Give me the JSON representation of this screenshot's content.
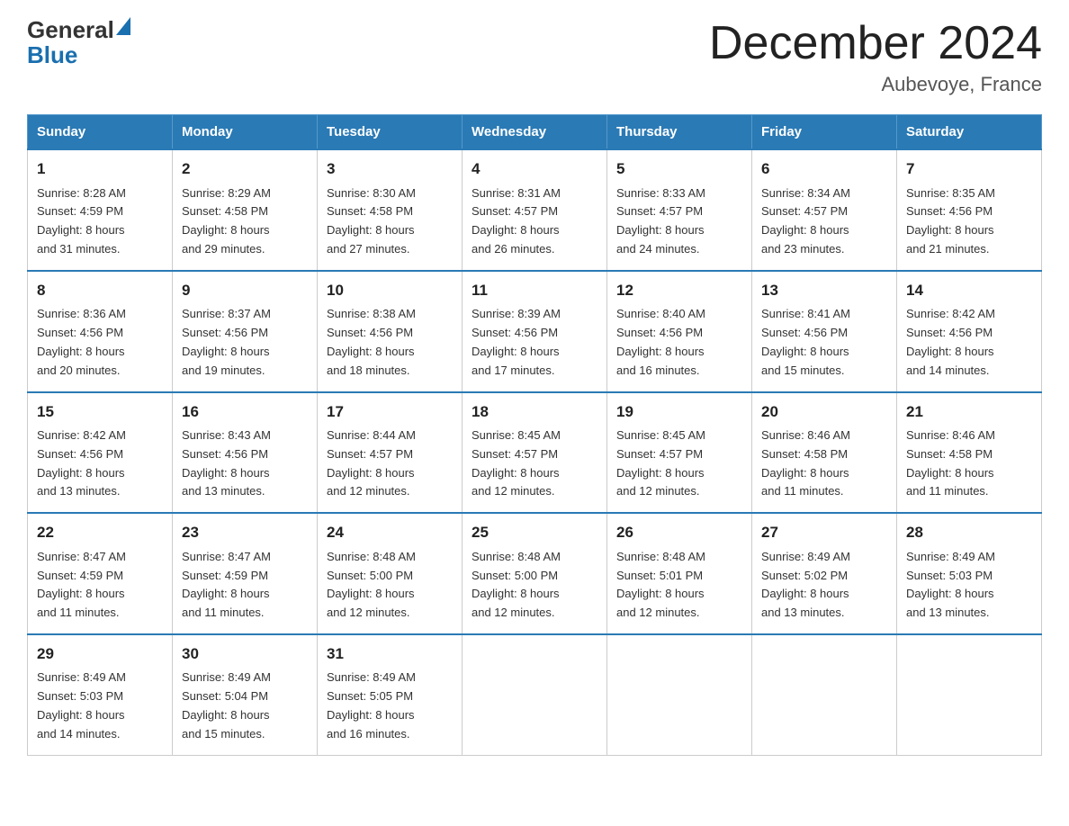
{
  "header": {
    "logo_general": "General",
    "logo_blue": "Blue",
    "month_title": "December 2024",
    "location": "Aubevoye, France"
  },
  "days_of_week": [
    "Sunday",
    "Monday",
    "Tuesday",
    "Wednesday",
    "Thursday",
    "Friday",
    "Saturday"
  ],
  "weeks": [
    [
      {
        "day": "1",
        "sunrise": "8:28 AM",
        "sunset": "4:59 PM",
        "daylight": "8 hours and 31 minutes."
      },
      {
        "day": "2",
        "sunrise": "8:29 AM",
        "sunset": "4:58 PM",
        "daylight": "8 hours and 29 minutes."
      },
      {
        "day": "3",
        "sunrise": "8:30 AM",
        "sunset": "4:58 PM",
        "daylight": "8 hours and 27 minutes."
      },
      {
        "day": "4",
        "sunrise": "8:31 AM",
        "sunset": "4:57 PM",
        "daylight": "8 hours and 26 minutes."
      },
      {
        "day": "5",
        "sunrise": "8:33 AM",
        "sunset": "4:57 PM",
        "daylight": "8 hours and 24 minutes."
      },
      {
        "day": "6",
        "sunrise": "8:34 AM",
        "sunset": "4:57 PM",
        "daylight": "8 hours and 23 minutes."
      },
      {
        "day": "7",
        "sunrise": "8:35 AM",
        "sunset": "4:56 PM",
        "daylight": "8 hours and 21 minutes."
      }
    ],
    [
      {
        "day": "8",
        "sunrise": "8:36 AM",
        "sunset": "4:56 PM",
        "daylight": "8 hours and 20 minutes."
      },
      {
        "day": "9",
        "sunrise": "8:37 AM",
        "sunset": "4:56 PM",
        "daylight": "8 hours and 19 minutes."
      },
      {
        "day": "10",
        "sunrise": "8:38 AM",
        "sunset": "4:56 PM",
        "daylight": "8 hours and 18 minutes."
      },
      {
        "day": "11",
        "sunrise": "8:39 AM",
        "sunset": "4:56 PM",
        "daylight": "8 hours and 17 minutes."
      },
      {
        "day": "12",
        "sunrise": "8:40 AM",
        "sunset": "4:56 PM",
        "daylight": "8 hours and 16 minutes."
      },
      {
        "day": "13",
        "sunrise": "8:41 AM",
        "sunset": "4:56 PM",
        "daylight": "8 hours and 15 minutes."
      },
      {
        "day": "14",
        "sunrise": "8:42 AM",
        "sunset": "4:56 PM",
        "daylight": "8 hours and 14 minutes."
      }
    ],
    [
      {
        "day": "15",
        "sunrise": "8:42 AM",
        "sunset": "4:56 PM",
        "daylight": "8 hours and 13 minutes."
      },
      {
        "day": "16",
        "sunrise": "8:43 AM",
        "sunset": "4:56 PM",
        "daylight": "8 hours and 13 minutes."
      },
      {
        "day": "17",
        "sunrise": "8:44 AM",
        "sunset": "4:57 PM",
        "daylight": "8 hours and 12 minutes."
      },
      {
        "day": "18",
        "sunrise": "8:45 AM",
        "sunset": "4:57 PM",
        "daylight": "8 hours and 12 minutes."
      },
      {
        "day": "19",
        "sunrise": "8:45 AM",
        "sunset": "4:57 PM",
        "daylight": "8 hours and 12 minutes."
      },
      {
        "day": "20",
        "sunrise": "8:46 AM",
        "sunset": "4:58 PM",
        "daylight": "8 hours and 11 minutes."
      },
      {
        "day": "21",
        "sunrise": "8:46 AM",
        "sunset": "4:58 PM",
        "daylight": "8 hours and 11 minutes."
      }
    ],
    [
      {
        "day": "22",
        "sunrise": "8:47 AM",
        "sunset": "4:59 PM",
        "daylight": "8 hours and 11 minutes."
      },
      {
        "day": "23",
        "sunrise": "8:47 AM",
        "sunset": "4:59 PM",
        "daylight": "8 hours and 11 minutes."
      },
      {
        "day": "24",
        "sunrise": "8:48 AM",
        "sunset": "5:00 PM",
        "daylight": "8 hours and 12 minutes."
      },
      {
        "day": "25",
        "sunrise": "8:48 AM",
        "sunset": "5:00 PM",
        "daylight": "8 hours and 12 minutes."
      },
      {
        "day": "26",
        "sunrise": "8:48 AM",
        "sunset": "5:01 PM",
        "daylight": "8 hours and 12 minutes."
      },
      {
        "day": "27",
        "sunrise": "8:49 AM",
        "sunset": "5:02 PM",
        "daylight": "8 hours and 13 minutes."
      },
      {
        "day": "28",
        "sunrise": "8:49 AM",
        "sunset": "5:03 PM",
        "daylight": "8 hours and 13 minutes."
      }
    ],
    [
      {
        "day": "29",
        "sunrise": "8:49 AM",
        "sunset": "5:03 PM",
        "daylight": "8 hours and 14 minutes."
      },
      {
        "day": "30",
        "sunrise": "8:49 AM",
        "sunset": "5:04 PM",
        "daylight": "8 hours and 15 minutes."
      },
      {
        "day": "31",
        "sunrise": "8:49 AM",
        "sunset": "5:05 PM",
        "daylight": "8 hours and 16 minutes."
      },
      null,
      null,
      null,
      null
    ]
  ],
  "labels": {
    "sunrise": "Sunrise:",
    "sunset": "Sunset:",
    "daylight": "Daylight:"
  }
}
